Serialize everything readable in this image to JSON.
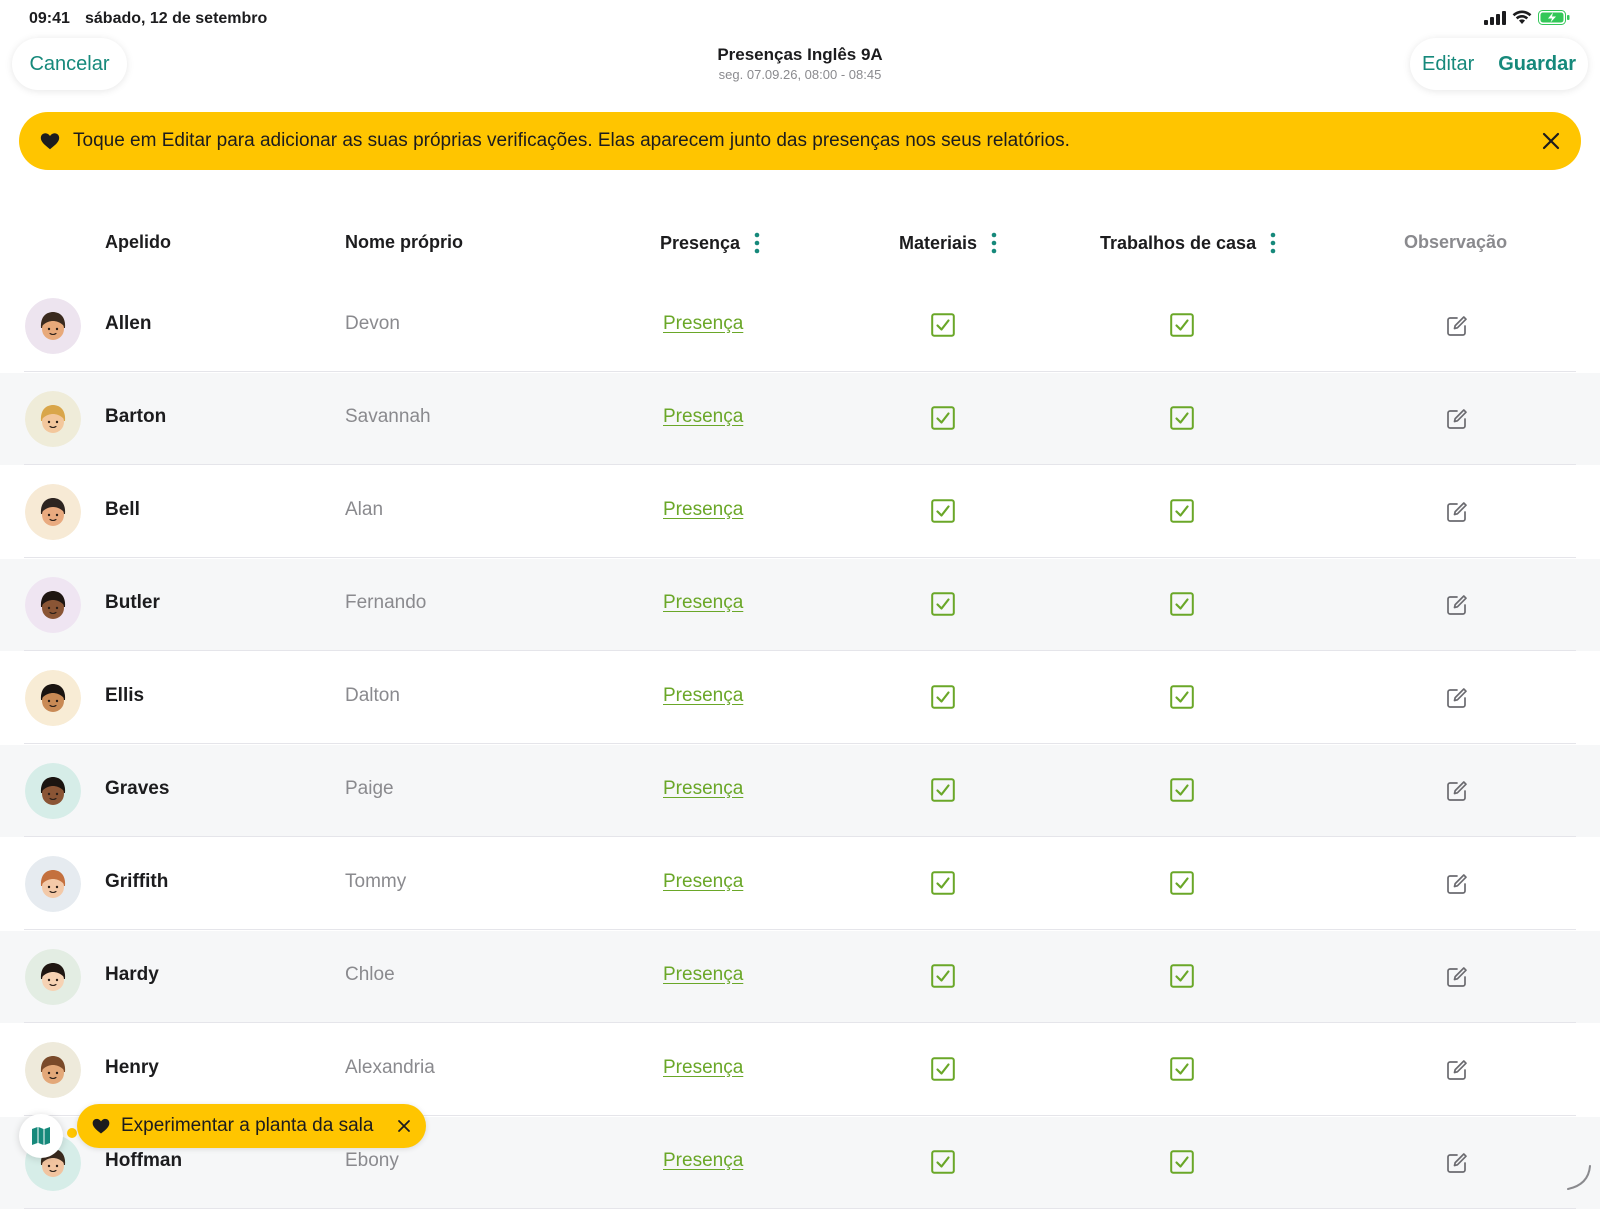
{
  "status_bar": {
    "time": "09:41",
    "date": "sábado, 12 de setembro"
  },
  "nav": {
    "cancel_label": "Cancelar",
    "title": "Presenças Inglês 9A",
    "subtitle": "seg. 07.09.26, 08:00 - 08:45",
    "edit_label": "Editar",
    "save_label": "Guardar"
  },
  "banner": {
    "text": "Toque em Editar para adicionar as suas próprias verificações. Elas aparecem junto das presenças nos seus relatórios."
  },
  "table": {
    "headers": {
      "surname": "Apelido",
      "given": "Nome próprio",
      "presence": "Presença",
      "materials": "Materiais",
      "homework": "Trabalhos de casa",
      "note": "Observação"
    },
    "rows": [
      {
        "surname": "Allen",
        "given": "Devon",
        "presence": "Presença",
        "materials": true,
        "homework": true,
        "avatar_bg": "#ede4ef",
        "skin": "#e8a97a",
        "hair": "#3a2a1e"
      },
      {
        "surname": "Barton",
        "given": "Savannah",
        "presence": "Presença",
        "materials": true,
        "homework": true,
        "avatar_bg": "#efecd9",
        "skin": "#f3c79c",
        "hair": "#d9a64a"
      },
      {
        "surname": "Bell",
        "given": "Alan",
        "presence": "Presença",
        "materials": true,
        "homework": true,
        "avatar_bg": "#f7ead5",
        "skin": "#e9aa7f",
        "hair": "#2d2420"
      },
      {
        "surname": "Butler",
        "given": "Fernando",
        "presence": "Presença",
        "materials": true,
        "homework": true,
        "avatar_bg": "#efe5f2",
        "skin": "#8a5535",
        "hair": "#1f1612"
      },
      {
        "surname": "Ellis",
        "given": "Dalton",
        "presence": "Presença",
        "materials": true,
        "homework": true,
        "avatar_bg": "#f8ecd5",
        "skin": "#c98a55",
        "hair": "#1a1410"
      },
      {
        "surname": "Graves",
        "given": "Paige",
        "presence": "Presença",
        "materials": true,
        "homework": true,
        "avatar_bg": "#d6ede8",
        "skin": "#8a5535",
        "hair": "#1a1410"
      },
      {
        "surname": "Griffith",
        "given": "Tommy",
        "presence": "Presença",
        "materials": true,
        "homework": true,
        "avatar_bg": "#e6ebf0",
        "skin": "#f3c9a8",
        "hair": "#c4703e"
      },
      {
        "surname": "Hardy",
        "given": "Chloe",
        "presence": "Presença",
        "materials": true,
        "homework": true,
        "avatar_bg": "#e3ede3",
        "skin": "#f6d2b3",
        "hair": "#1f1612"
      },
      {
        "surname": "Henry",
        "given": "Alexandria",
        "presence": "Presença",
        "materials": true,
        "homework": true,
        "avatar_bg": "#eeeadb",
        "skin": "#e3a879",
        "hair": "#7a4a2a"
      },
      {
        "surname": "Hoffman",
        "given": "Ebony",
        "presence": "Presença",
        "materials": true,
        "homework": true,
        "avatar_bg": "#d6ede8",
        "skin": "#f1c4a0",
        "hair": "#3a2a1e"
      }
    ]
  },
  "tooltip": {
    "text": "Experimentar a planta da sala"
  },
  "colors": {
    "accent": "#16897b",
    "yellow": "#ffc500",
    "green": "#6aa728"
  }
}
